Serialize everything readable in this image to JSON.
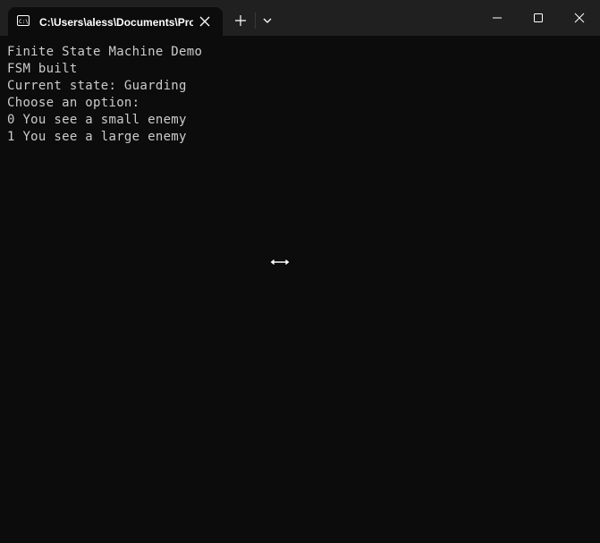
{
  "window": {
    "tab_title": "C:\\Users\\aless\\Documents\\Pro",
    "icons": {
      "tab": "terminal-icon",
      "tab_close": "close-icon",
      "new_tab": "plus-icon",
      "dropdown": "chevron-down-icon",
      "minimize": "minimize-icon",
      "maximize": "maximize-icon",
      "close": "close-icon"
    }
  },
  "terminal": {
    "lines": [
      "Finite State Machine Demo",
      "FSM built",
      "Current state: Guarding",
      "Choose an option:",
      "0 You see a small enemy",
      "1 You see a large enemy"
    ]
  },
  "colors": {
    "titlebar": "#202020",
    "background": "#0c0c0c",
    "text": "#cccccc"
  }
}
